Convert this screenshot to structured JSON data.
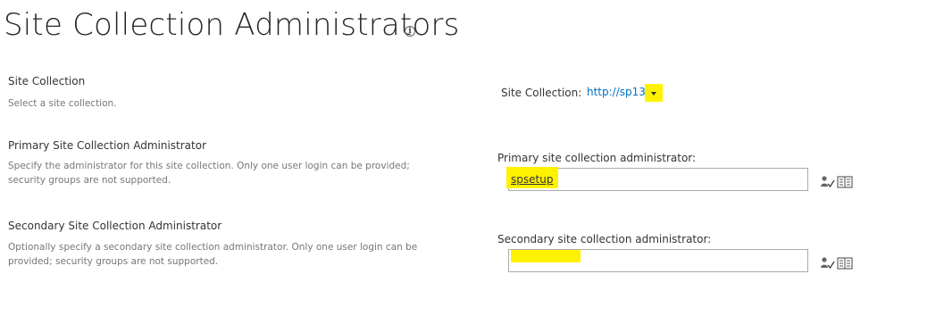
{
  "page": {
    "title": "Site Collection Administrators",
    "info_icon": "info-icon"
  },
  "site_collection_section": {
    "title": "Site Collection",
    "description": "Select a site collection.",
    "field_label": "Site Collection:",
    "selected_url": "http://sp13",
    "dropdown_icon": "chevron-down-icon"
  },
  "primary_admin_section": {
    "title": "Primary Site Collection Administrator",
    "description": "Specify the administrator for this site collection. Only one user login can be provided; security groups are not supported.",
    "field_label": "Primary site collection administrator:",
    "value": "spsetup",
    "check_names_icon": "check-names-icon",
    "browse_icon": "address-book-icon"
  },
  "secondary_admin_section": {
    "title": "Secondary Site Collection Administrator",
    "description": "Optionally specify a secondary site collection administrator. Only one user login can be provided; security groups are not supported.",
    "field_label": "Secondary site collection administrator:",
    "value": "",
    "check_names_icon": "check-names-icon",
    "browse_icon": "address-book-icon"
  },
  "colors": {
    "highlight": "#fff200",
    "link": "#0072c6",
    "title": "#262626",
    "description": "#777777"
  }
}
